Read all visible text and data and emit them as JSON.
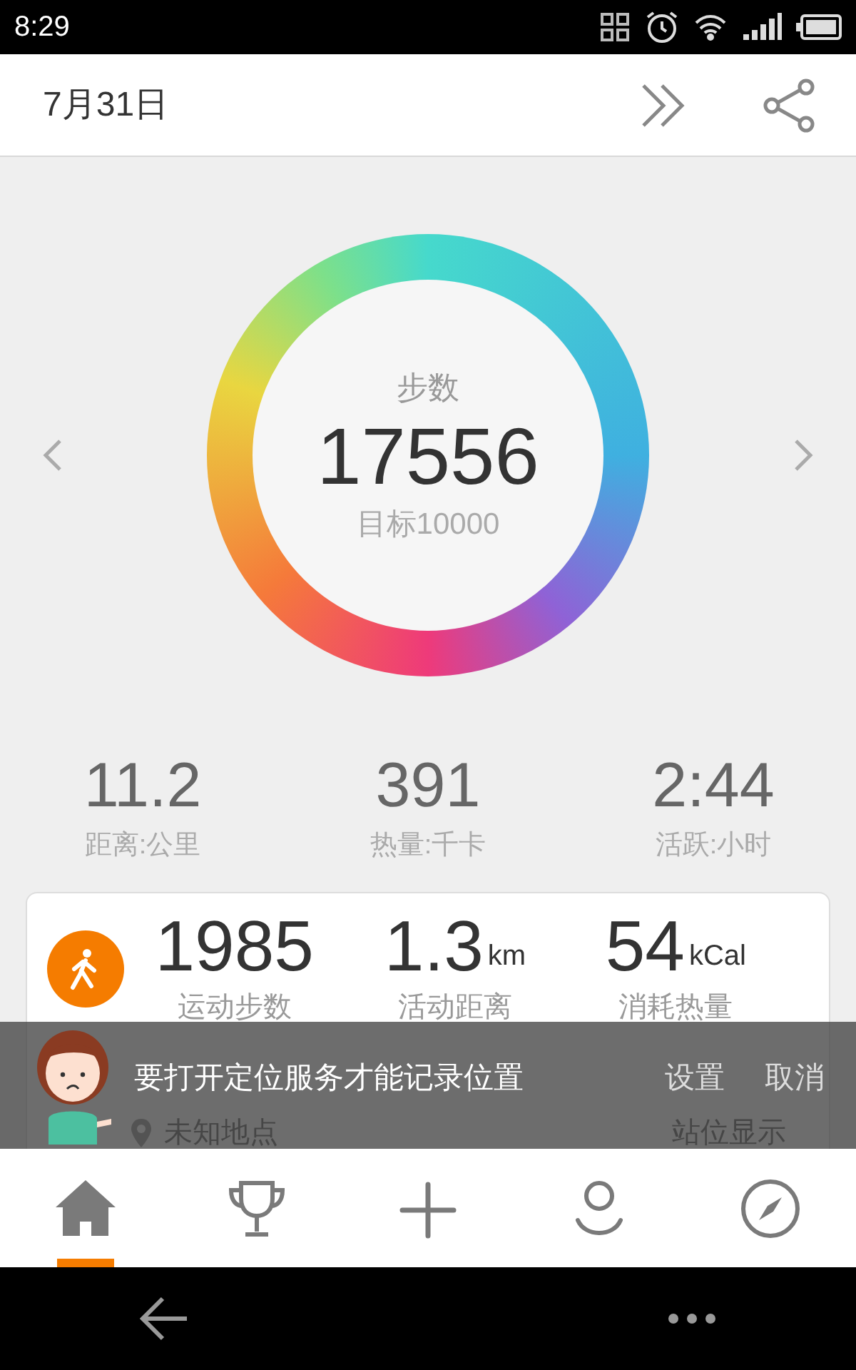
{
  "status_bar": {
    "time": "8:29"
  },
  "header": {
    "date": "7月31日"
  },
  "ring": {
    "label": "步数",
    "steps": "17556",
    "goal": "目标10000"
  },
  "stats": [
    {
      "value": "11.2",
      "label": "距离:公里"
    },
    {
      "value": "391",
      "label": "热量:千卡"
    },
    {
      "value": "2:44",
      "label": "活跃:小时"
    }
  ],
  "activity_card": {
    "items": [
      {
        "value": "1985",
        "label": "运动步数"
      },
      {
        "value": "1.3",
        "unit": "km",
        "label": "活动距离"
      },
      {
        "value": "54",
        "unit": "kCal",
        "label": "消耗热量"
      }
    ],
    "location": "未知地点",
    "location_action": "站位显示"
  },
  "toast": {
    "message": "要打开定位服务才能记录位置",
    "actions": [
      "设置",
      "取消"
    ]
  },
  "tabs": [
    {
      "kind": "home",
      "selected": true
    },
    {
      "kind": "trophy",
      "selected": false
    },
    {
      "kind": "add",
      "selected": false
    },
    {
      "kind": "profile",
      "selected": false
    },
    {
      "kind": "compass",
      "selected": false
    }
  ]
}
